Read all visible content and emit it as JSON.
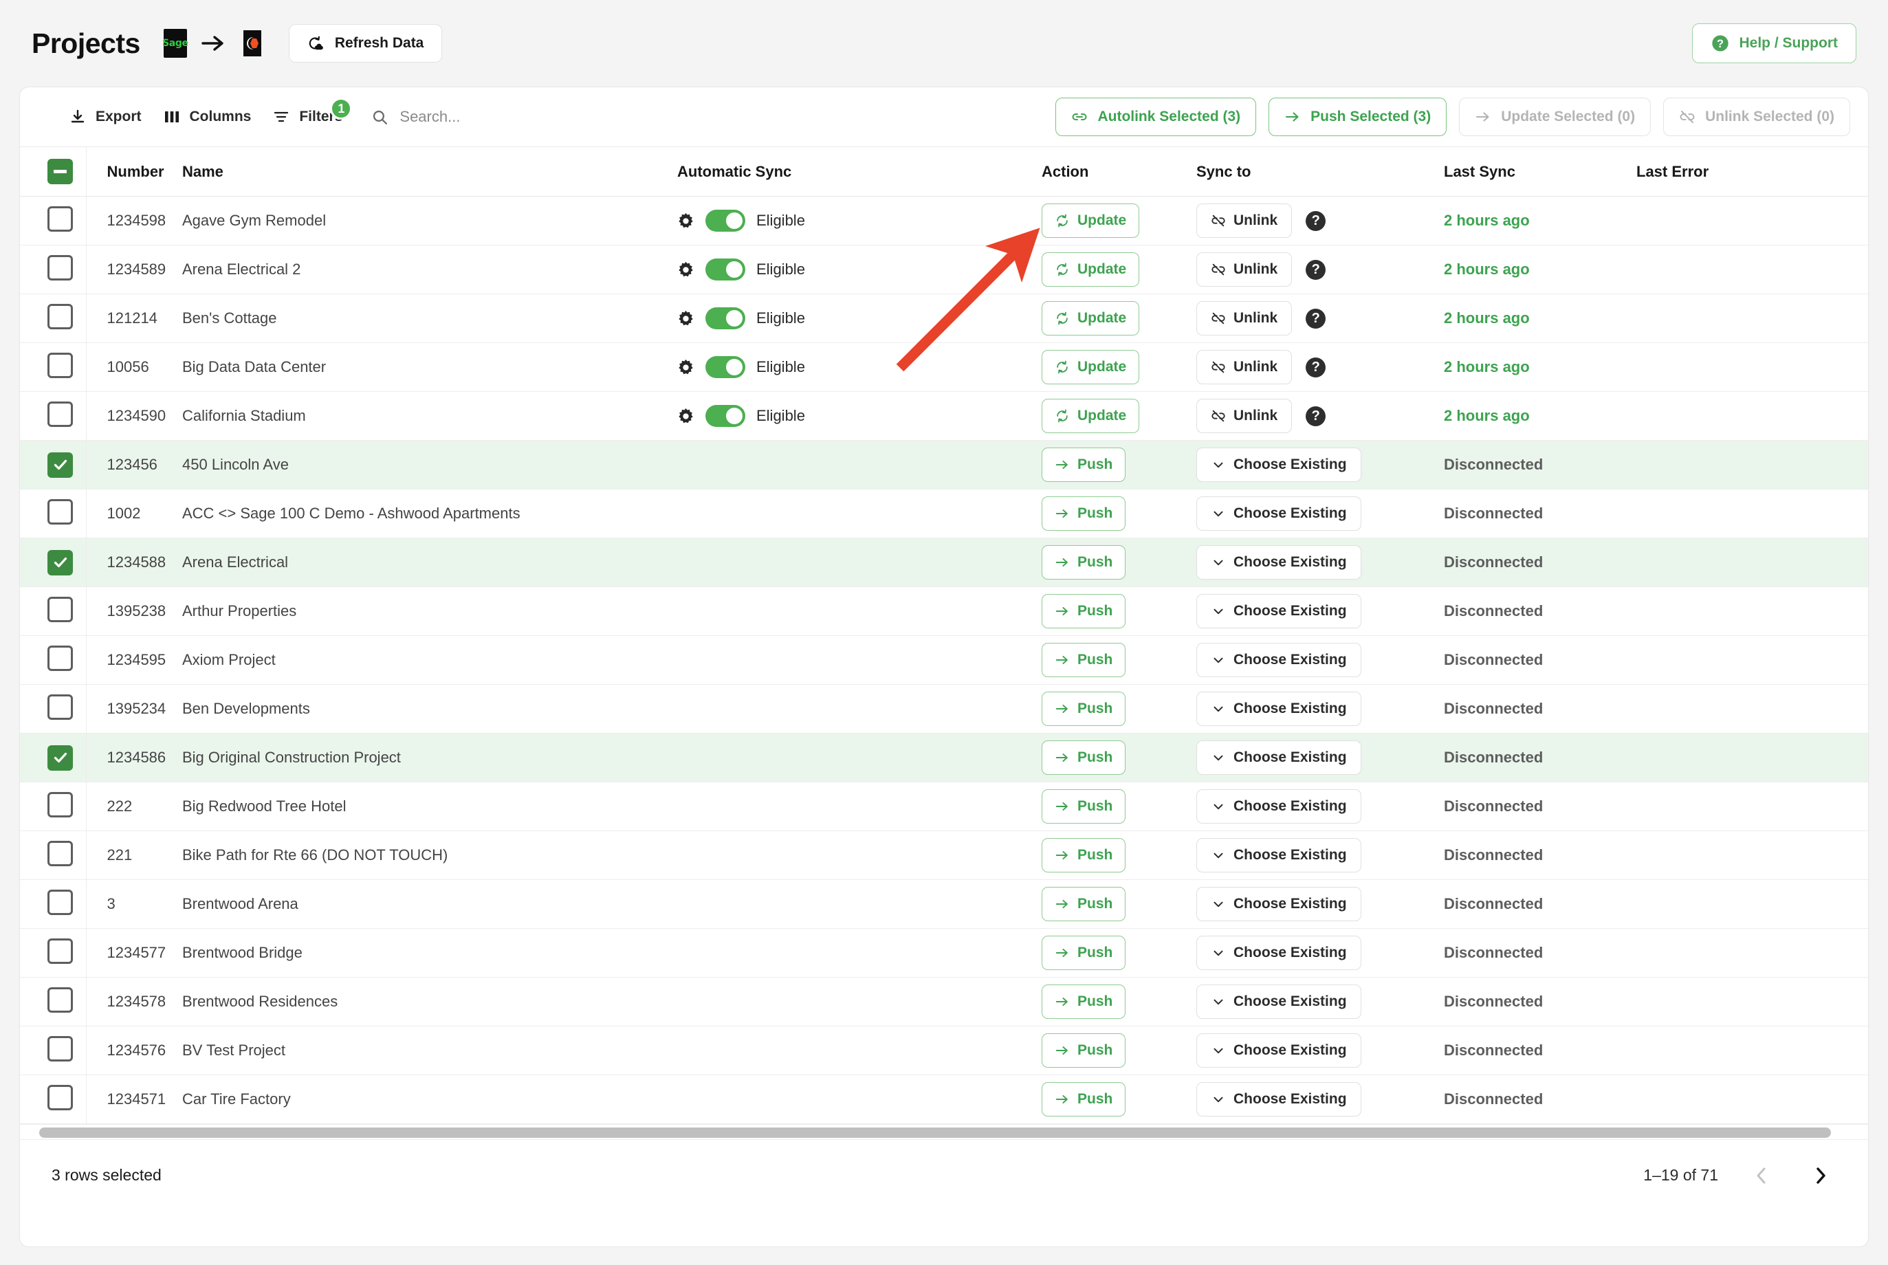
{
  "header": {
    "title": "Projects",
    "source_logo_text": "Sage",
    "source_logo_name": "sage-logo",
    "flow_arrow_name": "arrow-right-icon",
    "target_logo_name": "procore-logo",
    "refresh_label": "Refresh Data",
    "refresh_icon": "refresh-cloud-icon",
    "help_label": "Help / Support",
    "help_icon": "help-circle-icon"
  },
  "toolbar": {
    "export_label": "Export",
    "export_icon": "download-icon",
    "columns_label": "Columns",
    "columns_icon": "columns-icon",
    "filters_label": "Filters",
    "filters_icon": "filter-icon",
    "filters_badge": "1",
    "search_placeholder": "Search...",
    "search_value": "",
    "search_icon": "search-icon",
    "bulk": [
      {
        "label": "Autolink Selected (3)",
        "icon": "link-icon",
        "state": "enabled",
        "name": "autolink-selected-button"
      },
      {
        "label": "Push Selected (3)",
        "icon": "arrow-right-icon",
        "state": "enabled",
        "name": "push-selected-button"
      },
      {
        "label": "Update Selected (0)",
        "icon": "arrow-right-icon",
        "state": "disabled",
        "name": "update-selected-button"
      },
      {
        "label": "Unlink Selected (0)",
        "icon": "unlink-icon",
        "state": "disabled",
        "name": "unlink-selected-button"
      }
    ]
  },
  "table": {
    "select_all_state": "indeterminate",
    "columns": {
      "number": "Number",
      "name": "Name",
      "automatic_sync": "Automatic Sync",
      "action": "Action",
      "sync_to": "Sync to",
      "last_sync": "Last Sync",
      "last_error": "Last Error"
    },
    "rows": [
      {
        "checked": false,
        "number": "1234598",
        "name": "Agave Gym Remodel",
        "linked": true,
        "sync_label": "Eligible",
        "action_label": "Update",
        "action_icon": "refresh-icon",
        "syncto_label": "Unlink",
        "syncto_icon": "unlink-icon",
        "has_help": true,
        "last_sync": "2 hours ago",
        "last_sync_tone": "green",
        "last_error": ""
      },
      {
        "checked": false,
        "number": "1234589",
        "name": "Arena Electrical 2",
        "linked": true,
        "sync_label": "Eligible",
        "action_label": "Update",
        "action_icon": "refresh-icon",
        "syncto_label": "Unlink",
        "syncto_icon": "unlink-icon",
        "has_help": true,
        "last_sync": "2 hours ago",
        "last_sync_tone": "green",
        "last_error": ""
      },
      {
        "checked": false,
        "number": "121214",
        "name": "Ben's Cottage",
        "linked": true,
        "sync_label": "Eligible",
        "action_label": "Update",
        "action_icon": "refresh-icon",
        "syncto_label": "Unlink",
        "syncto_icon": "unlink-icon",
        "has_help": true,
        "last_sync": "2 hours ago",
        "last_sync_tone": "green",
        "last_error": ""
      },
      {
        "checked": false,
        "number": "10056",
        "name": "Big Data Data Center",
        "linked": true,
        "sync_label": "Eligible",
        "action_label": "Update",
        "action_icon": "refresh-icon",
        "syncto_label": "Unlink",
        "syncto_icon": "unlink-icon",
        "has_help": true,
        "last_sync": "2 hours ago",
        "last_sync_tone": "green",
        "last_error": ""
      },
      {
        "checked": false,
        "number": "1234590",
        "name": "California Stadium",
        "linked": true,
        "sync_label": "Eligible",
        "action_label": "Update",
        "action_icon": "refresh-icon",
        "syncto_label": "Unlink",
        "syncto_icon": "unlink-icon",
        "has_help": true,
        "last_sync": "2 hours ago",
        "last_sync_tone": "green",
        "last_error": ""
      },
      {
        "checked": true,
        "number": "123456",
        "name": "450 Lincoln Ave",
        "linked": false,
        "sync_label": "",
        "action_label": "Push",
        "action_icon": "arrow-right-icon",
        "syncto_label": "Choose Existing",
        "syncto_icon": "chevron-down-icon",
        "has_help": false,
        "last_sync": "Disconnected",
        "last_sync_tone": "grey",
        "last_error": ""
      },
      {
        "checked": false,
        "number": "1002",
        "name": "ACC <> Sage 100 C Demo - Ashwood Apartments",
        "linked": false,
        "sync_label": "",
        "action_label": "Push",
        "action_icon": "arrow-right-icon",
        "syncto_label": "Choose Existing",
        "syncto_icon": "chevron-down-icon",
        "has_help": false,
        "last_sync": "Disconnected",
        "last_sync_tone": "grey",
        "last_error": ""
      },
      {
        "checked": true,
        "number": "1234588",
        "name": "Arena Electrical",
        "linked": false,
        "sync_label": "",
        "action_label": "Push",
        "action_icon": "arrow-right-icon",
        "syncto_label": "Choose Existing",
        "syncto_icon": "chevron-down-icon",
        "has_help": false,
        "last_sync": "Disconnected",
        "last_sync_tone": "grey",
        "last_error": ""
      },
      {
        "checked": false,
        "number": "1395238",
        "name": "Arthur Properties",
        "linked": false,
        "sync_label": "",
        "action_label": "Push",
        "action_icon": "arrow-right-icon",
        "syncto_label": "Choose Existing",
        "syncto_icon": "chevron-down-icon",
        "has_help": false,
        "last_sync": "Disconnected",
        "last_sync_tone": "grey",
        "last_error": ""
      },
      {
        "checked": false,
        "number": "1234595",
        "name": "Axiom Project",
        "linked": false,
        "sync_label": "",
        "action_label": "Push",
        "action_icon": "arrow-right-icon",
        "syncto_label": "Choose Existing",
        "syncto_icon": "chevron-down-icon",
        "has_help": false,
        "last_sync": "Disconnected",
        "last_sync_tone": "grey",
        "last_error": ""
      },
      {
        "checked": false,
        "number": "1395234",
        "name": "Ben Developments",
        "linked": false,
        "sync_label": "",
        "action_label": "Push",
        "action_icon": "arrow-right-icon",
        "syncto_label": "Choose Existing",
        "syncto_icon": "chevron-down-icon",
        "has_help": false,
        "last_sync": "Disconnected",
        "last_sync_tone": "grey",
        "last_error": ""
      },
      {
        "checked": true,
        "number": "1234586",
        "name": "Big Original Construction Project",
        "linked": false,
        "sync_label": "",
        "action_label": "Push",
        "action_icon": "arrow-right-icon",
        "syncto_label": "Choose Existing",
        "syncto_icon": "chevron-down-icon",
        "has_help": false,
        "last_sync": "Disconnected",
        "last_sync_tone": "grey",
        "last_error": ""
      },
      {
        "checked": false,
        "number": "222",
        "name": "Big Redwood Tree Hotel",
        "linked": false,
        "sync_label": "",
        "action_label": "Push",
        "action_icon": "arrow-right-icon",
        "syncto_label": "Choose Existing",
        "syncto_icon": "chevron-down-icon",
        "has_help": false,
        "last_sync": "Disconnected",
        "last_sync_tone": "grey",
        "last_error": ""
      },
      {
        "checked": false,
        "number": "221",
        "name": "Bike Path for Rte 66 (DO NOT TOUCH)",
        "linked": false,
        "sync_label": "",
        "action_label": "Push",
        "action_icon": "arrow-right-icon",
        "syncto_label": "Choose Existing",
        "syncto_icon": "chevron-down-icon",
        "has_help": false,
        "last_sync": "Disconnected",
        "last_sync_tone": "grey",
        "last_error": ""
      },
      {
        "checked": false,
        "number": "3",
        "name": "Brentwood Arena",
        "linked": false,
        "sync_label": "",
        "action_label": "Push",
        "action_icon": "arrow-right-icon",
        "syncto_label": "Choose Existing",
        "syncto_icon": "chevron-down-icon",
        "has_help": false,
        "last_sync": "Disconnected",
        "last_sync_tone": "grey",
        "last_error": ""
      },
      {
        "checked": false,
        "number": "1234577",
        "name": "Brentwood Bridge",
        "linked": false,
        "sync_label": "",
        "action_label": "Push",
        "action_icon": "arrow-right-icon",
        "syncto_label": "Choose Existing",
        "syncto_icon": "chevron-down-icon",
        "has_help": false,
        "last_sync": "Disconnected",
        "last_sync_tone": "grey",
        "last_error": ""
      },
      {
        "checked": false,
        "number": "1234578",
        "name": "Brentwood Residences",
        "linked": false,
        "sync_label": "",
        "action_label": "Push",
        "action_icon": "arrow-right-icon",
        "syncto_label": "Choose Existing",
        "syncto_icon": "chevron-down-icon",
        "has_help": false,
        "last_sync": "Disconnected",
        "last_sync_tone": "grey",
        "last_error": ""
      },
      {
        "checked": false,
        "number": "1234576",
        "name": "BV Test Project",
        "linked": false,
        "sync_label": "",
        "action_label": "Push",
        "action_icon": "arrow-right-icon",
        "syncto_label": "Choose Existing",
        "syncto_icon": "chevron-down-icon",
        "has_help": false,
        "last_sync": "Disconnected",
        "last_sync_tone": "grey",
        "last_error": ""
      },
      {
        "checked": false,
        "number": "1234571",
        "name": "Car Tire Factory",
        "linked": false,
        "sync_label": "",
        "action_label": "Push",
        "action_icon": "arrow-right-icon",
        "syncto_label": "Choose Existing",
        "syncto_icon": "chevron-down-icon",
        "has_help": false,
        "last_sync": "Disconnected",
        "last_sync_tone": "grey",
        "last_error": ""
      }
    ]
  },
  "footer": {
    "rows_selected": "3 rows selected",
    "range": "1–19 of 71",
    "prev_icon": "chevron-left-icon",
    "next_icon": "chevron-right-icon",
    "prev_state": "disabled",
    "next_state": "enabled"
  },
  "annotation": {
    "arrow_color": "#e8422a",
    "arrow_name": "annotation-arrow"
  },
  "colors": {
    "accent_green": "#3da350",
    "toggle_green": "#4caf50",
    "selected_row": "#eaf5ec",
    "page_bg": "#f4f4f4",
    "annotation_red": "#e8422a"
  }
}
